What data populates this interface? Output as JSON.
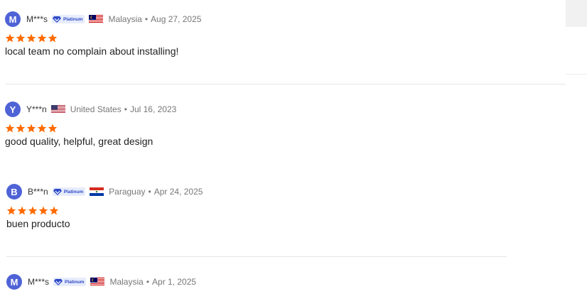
{
  "reviews": [
    {
      "avatar": "M",
      "user": "M***s",
      "platinum": true,
      "badge": "Platinum",
      "flag": "malaysia",
      "country": "Malaysia",
      "date": "Aug 27, 2025",
      "rating": 5,
      "comment": "local team no complain about installing!"
    },
    {
      "avatar": "Y",
      "user": "Y***n",
      "platinum": false,
      "badge": "",
      "flag": "united-states",
      "country": "United States",
      "date": "Jul 16, 2023",
      "rating": 5,
      "comment": "good quality, helpful, great design"
    },
    {
      "avatar": "B",
      "user": "B***n",
      "platinum": true,
      "badge": "Platinum",
      "flag": "paraguay",
      "country": "Paraguay",
      "date": "Apr 24, 2025",
      "rating": 5,
      "comment": "buen producto"
    },
    {
      "avatar": "M",
      "user": "M***s",
      "platinum": true,
      "badge": "Platinum",
      "flag": "malaysia",
      "country": "Malaysia",
      "date": "Apr 1, 2025",
      "rating": 5,
      "comment": ""
    }
  ],
  "separator": "•",
  "colors": {
    "avatar": "#4f63d6",
    "star": "#ff6a00",
    "badge_bg": "#e7ecfb",
    "badge_text": "#2d49c8",
    "muted": "#777777"
  },
  "icons": {
    "star": "star-icon",
    "badge": "diamond-icon"
  }
}
